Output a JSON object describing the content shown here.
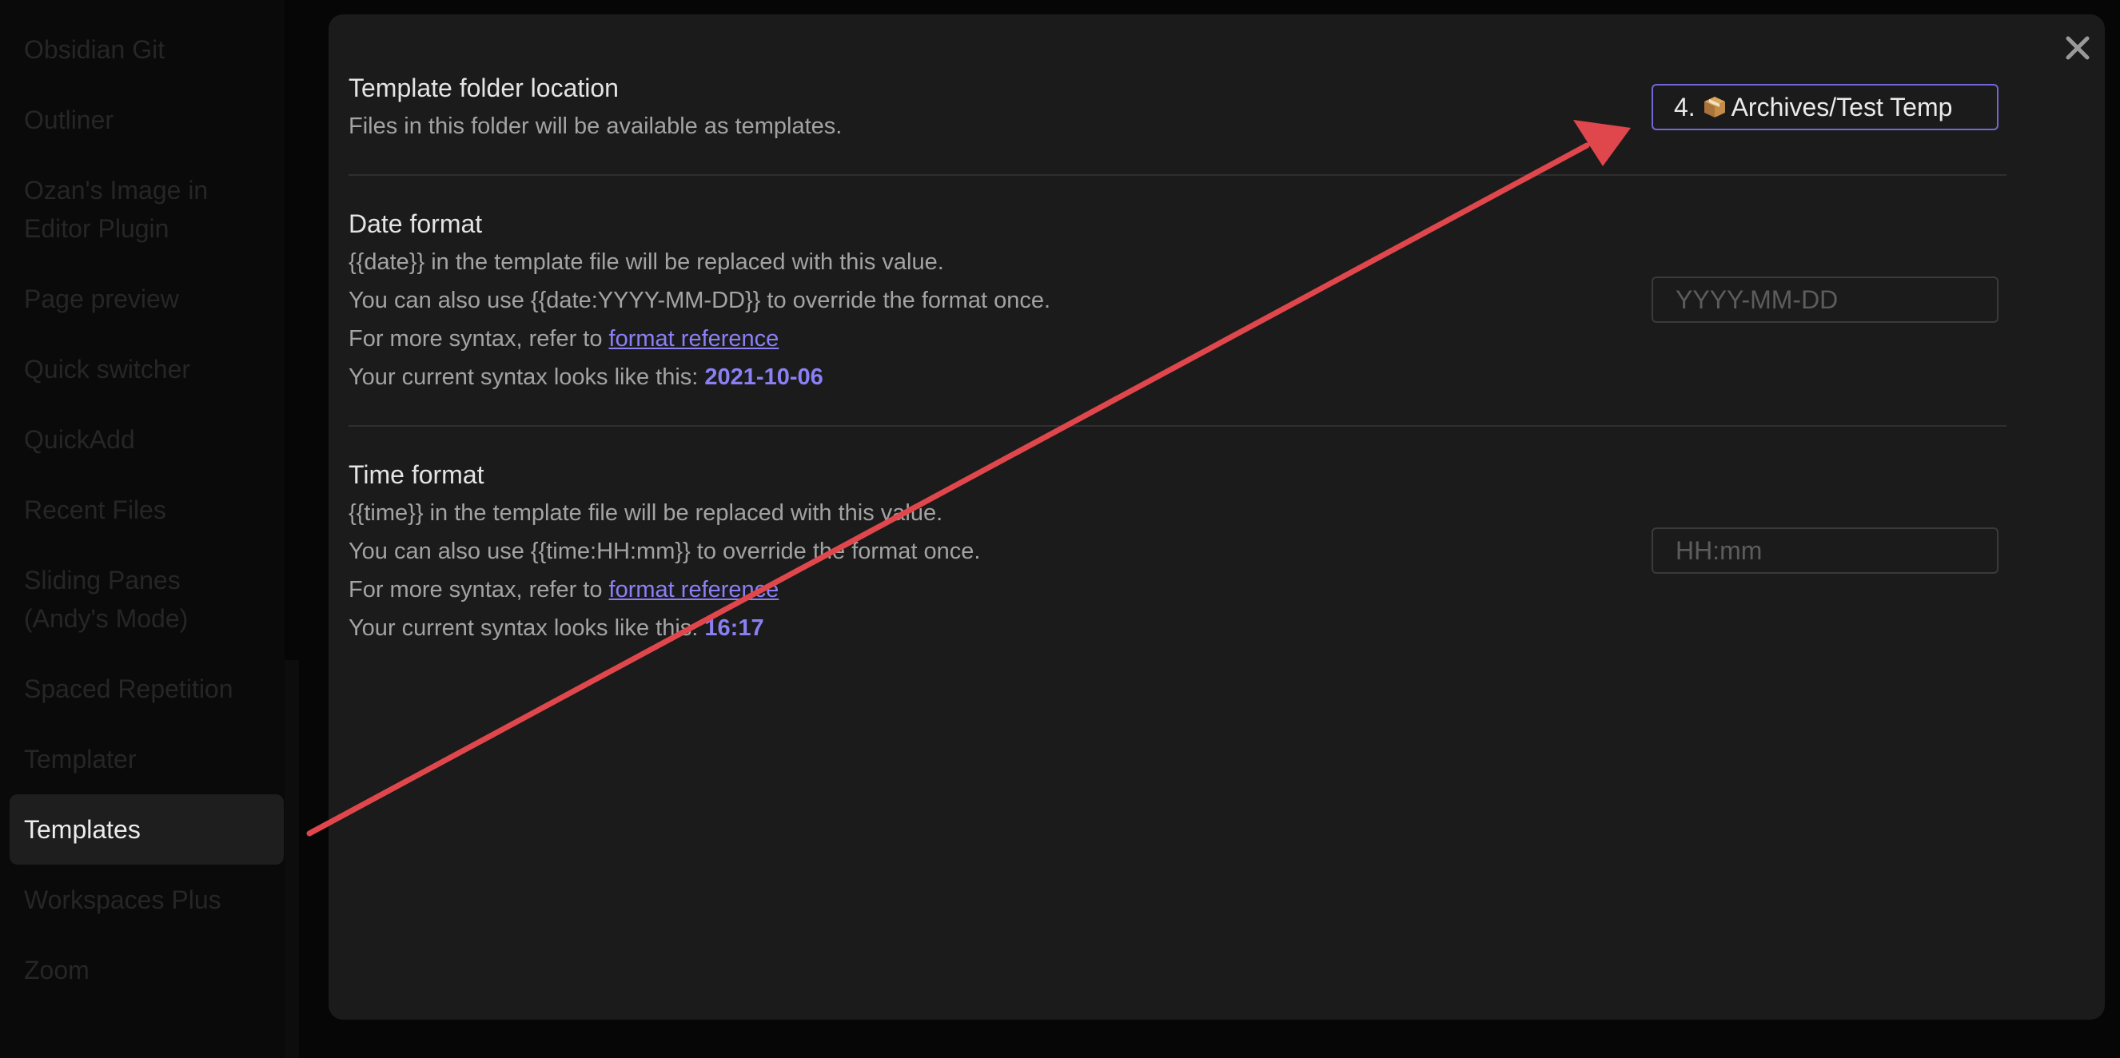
{
  "sidebar": {
    "items": [
      {
        "label": "Obsidian Git"
      },
      {
        "label": "Outliner"
      },
      {
        "label": "Ozan's Image in Editor Plugin"
      },
      {
        "label": "Page preview"
      },
      {
        "label": "Quick switcher"
      },
      {
        "label": "QuickAdd"
      },
      {
        "label": "Recent Files"
      },
      {
        "label": "Sliding Panes (Andy's Mode)"
      },
      {
        "label": "Spaced Repetition"
      },
      {
        "label": "Templater"
      },
      {
        "label": "Templates"
      },
      {
        "label": "Workspaces Plus"
      },
      {
        "label": "Zoom"
      }
    ],
    "active_item": "Templates"
  },
  "modal": {
    "close_icon": "close-icon",
    "template_folder": {
      "name": "Template folder location",
      "desc": "Files in this folder will be available as templates.",
      "value_prefix": "4. ",
      "value_icon": "package-icon",
      "value_text": "Archives/Test Temp"
    },
    "date_format": {
      "name": "Date format",
      "desc_line1": "{{date}} in the template file will be replaced with this value.",
      "desc_line2": "You can also use {{date:YYYY-MM-DD}} to override the format once.",
      "desc_line3_prefix": "For more syntax, refer to ",
      "desc_line3_link": "format reference",
      "desc_line4_prefix": "Your current syntax looks like this: ",
      "current_value": "2021-10-06",
      "placeholder": "YYYY-MM-DD"
    },
    "time_format": {
      "name": "Time format",
      "desc_line1": "{{time}} in the template file will be replaced with this value.",
      "desc_line2": "You can also use {{time:HH:mm}} to override the format once.",
      "desc_line3_prefix": "For more syntax, refer to ",
      "desc_line3_link": "format reference",
      "desc_line4_prefix": "Your current syntax looks like this: ",
      "current_value": "16:17",
      "placeholder": "HH:mm"
    }
  },
  "colors": {
    "accent": "#8a80f5",
    "annotation_arrow": "#e0474c",
    "modal_bg": "#1b1b1b"
  }
}
